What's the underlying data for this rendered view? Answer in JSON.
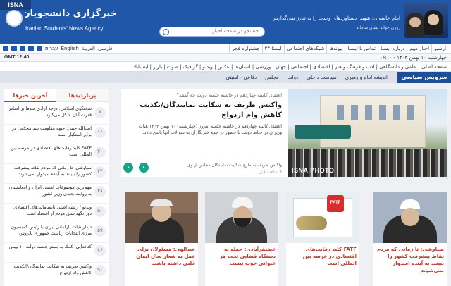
{
  "header": {
    "isna_tag": "ISNA",
    "logo_fa": "خبرگزاری دانشجویان ایران، ایسنا",
    "logo_en": "Iranian Students' News Agency",
    "search_placeholder": "جستجو در صفحهٔ اخبار",
    "banner_quote": "امام خامنه‌ای: شهید؛ دستاوردهای وحدت را به تبارز نمی‌گذاریم",
    "banner_sub": "روزی جوانه نشان سامانه"
  },
  "top_nav": {
    "items": [
      "آرشیو",
      "اخبار مهم",
      "درباره ایسنا",
      "تماس با ایسنا",
      "پیوندها",
      "شبکه‌های اجتماعی",
      "ایسنا ۲۴",
      "چشنواره فجر"
    ],
    "langs": [
      "فارسی",
      "العربية",
      "English",
      "עברית"
    ]
  },
  "date_bar": {
    "date": "چهارشنبه ۱۰ بهمن ۱۴۰۳ - ۱۶:۱۰",
    "gmt": "GMT 12:40"
  },
  "category_nav": {
    "text": "صفحه اصلی | علمی و دانشگاهی | ادب و فرهنگ و هنر | اقتصادی | اجتماعی | جهان | ورزشی | استان‌ها | عکس | ویدئو | گرافیک | صوت | بازار | ایسناباد"
  },
  "service_bar": {
    "label": "سرویس سیاسی",
    "tabs": [
      "اندیشه امام و رهبری",
      "سیاست داخلی",
      "دولت",
      "مجلس",
      "دفاعی - امنیتی"
    ]
  },
  "sidebar": {
    "tab_latest": "آخرین خبرها",
    "tab_popular": "پربازدیدها",
    "items": [
      {
        "num": "۸",
        "text": "سخنگوی اسلامی: درجه آزادی متدها بر اساس قدرت آنان شکل می‌گیرد"
      },
      {
        "num": "۱۶",
        "text": "آیت‌الله جنتی: جبهه مقاومت سد محکمی در برابر استکبار است"
      },
      {
        "num": "۲۰",
        "text": "FATF کلید رقابت‌های اقتصادی در عرصه بین المللی است"
      },
      {
        "num": "۴۴",
        "text": "سیاوشی: تا زمانی که مردم نقاط پیشرفت کشور را ببینند به آینده امیدوار نمی‌شوند"
      },
      {
        "num": "۴۸",
        "text": "مهم‌ترین موضوعات امنیتی ایران و افغانستان به روایت بعیدی وزیر کشور"
      },
      {
        "num": "۵۰",
        "text": "ویدئو / ریشه اصلی نابسامانی‌های اقتصادی؛ دور نگهداشتن مردم از اقتصاد است"
      },
      {
        "num": "۵۹",
        "text": "دیدار هیأت پارلمانی ایران با رئیس کمیسیون مرزی انتخابات ریاست جمهوری بلاروس"
      },
      {
        "num": "۸۶",
        "text": "کدخدایی: کمک به بستر جلسه دولت ۱۰ بهمن"
      },
      {
        "num": "۹۰",
        "text": "واکنش ظریف به شکایت نمایندگان/انکذیب کاهش وام ازدواج"
      }
    ]
  },
  "hero": {
    "kicker": "اعضای کابینه چهاردهم در حاشیه جلسه دولت چه گفتند؟",
    "title": "واکنش ظریف به شکایت نمایندگان/تکذیب کاهش وام ازدواج",
    "lead": "اعضای کابینه چهاردهم در حاشیه جلسه امروز (چهارشنبه) ۱۰ بهمن ۱۴۰۳ هیات وزیران در حیاط دولت با حضور در جمع خبرنگاران به سوالات آنها پاسخ دادند.",
    "related": "واکنش ظریف به طرح شکایت نمایندگان مجلس از وی",
    "time": "۹ ساعت قبل",
    "watermark": "ISNA PHOTO",
    "prev_arrow": "‹",
    "next_arrow": "›"
  },
  "cards": [
    {
      "caption": "سیاوشی: تا زمانی که مردم نقاط پیشرفت کشور را نبینند به آینده امیدوار نمی‌شوند"
    },
    {
      "caption": "FATF کلید رقابت‌های اقتصادی در عرصه بین المللی است"
    },
    {
      "caption": "غضنفرآبادی: حمله به دستگاه قضایی تحت هر عنوانی خوب نیست"
    },
    {
      "caption": "عبدالهی: مسئولان برای عمل به شعار سال ایمان قلبی داشته باشند"
    }
  ],
  "colors": {
    "brand_blue": "#2157a8",
    "accent_red": "#c0392b",
    "teal": "#17a589"
  }
}
